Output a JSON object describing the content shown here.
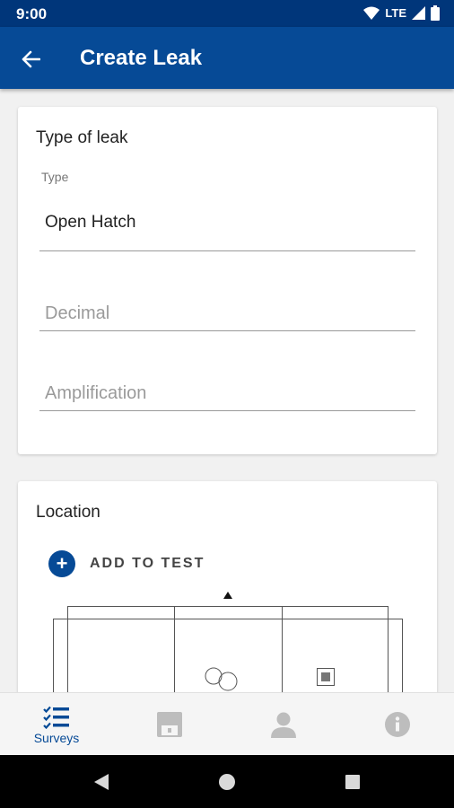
{
  "status_bar": {
    "time": "9:00",
    "network": "LTE"
  },
  "app_bar": {
    "title": "Create Leak",
    "back_icon": "arrow-back-icon"
  },
  "type_card": {
    "title": "Type of leak",
    "type_field": {
      "label": "Type",
      "value": "Open Hatch"
    },
    "decimal_field": {
      "placeholder": "Decimal"
    },
    "amplification_field": {
      "placeholder": "Amplification"
    }
  },
  "location_card": {
    "title": "Location",
    "add_button_label": "ADD TO TEST"
  },
  "bottom_nav": {
    "items": [
      {
        "label": "Surveys",
        "icon": "checklist-icon",
        "active": true
      },
      {
        "label": "",
        "icon": "save-icon",
        "active": false
      },
      {
        "label": "",
        "icon": "person-icon",
        "active": false
      },
      {
        "label": "",
        "icon": "info-icon",
        "active": false
      }
    ]
  },
  "colors": {
    "primary": "#064a96",
    "status_bar": "#00367a",
    "inactive_icon": "#bdbdbd"
  }
}
